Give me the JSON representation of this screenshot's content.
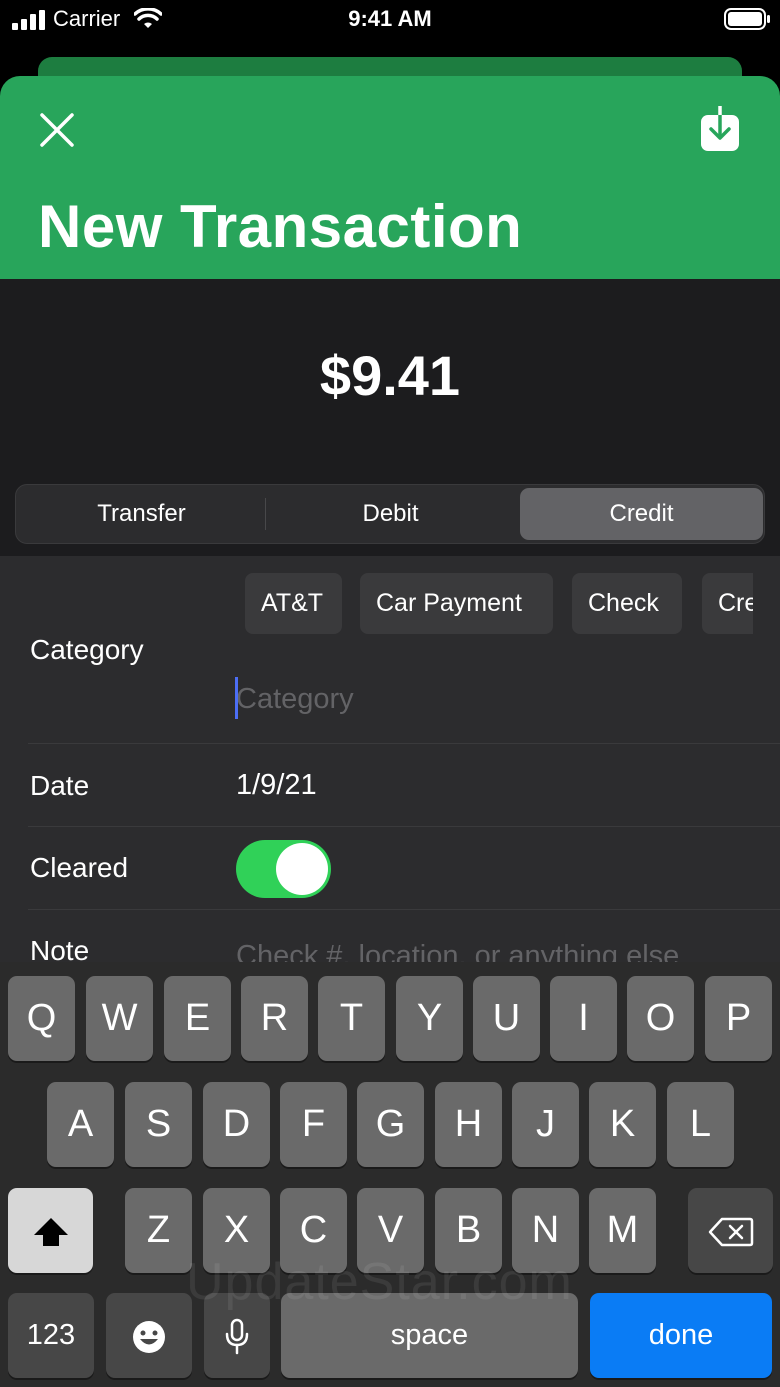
{
  "status_bar": {
    "carrier": "Carrier",
    "time": "9:41 AM"
  },
  "header": {
    "title": "New Transaction",
    "close_icon": "close-icon",
    "save_icon": "download-icon",
    "color": "#28a55b"
  },
  "amount": "$9.41",
  "type_selector": {
    "options": [
      "Transfer",
      "Debit",
      "Credit"
    ],
    "selected": "Credit"
  },
  "form": {
    "category": {
      "label": "Category",
      "suggestions": [
        "AT&T",
        "Car Payment",
        "Check",
        "Cre"
      ],
      "placeholder": "Category",
      "value": ""
    },
    "date": {
      "label": "Date",
      "value": "1/9/21"
    },
    "cleared": {
      "label": "Cleared",
      "on": true
    },
    "note": {
      "label": "Note",
      "placeholder": "Check #, location, or anything else"
    }
  },
  "keyboard": {
    "row1": [
      "Q",
      "W",
      "E",
      "R",
      "T",
      "Y",
      "U",
      "I",
      "O",
      "P"
    ],
    "row2": [
      "A",
      "S",
      "D",
      "F",
      "G",
      "H",
      "J",
      "K",
      "L"
    ],
    "row3": [
      "Z",
      "X",
      "C",
      "V",
      "B",
      "N",
      "M"
    ],
    "numbers_label": "123",
    "space_label": "space",
    "done_label": "done"
  },
  "watermark": "UpdateStar.com"
}
